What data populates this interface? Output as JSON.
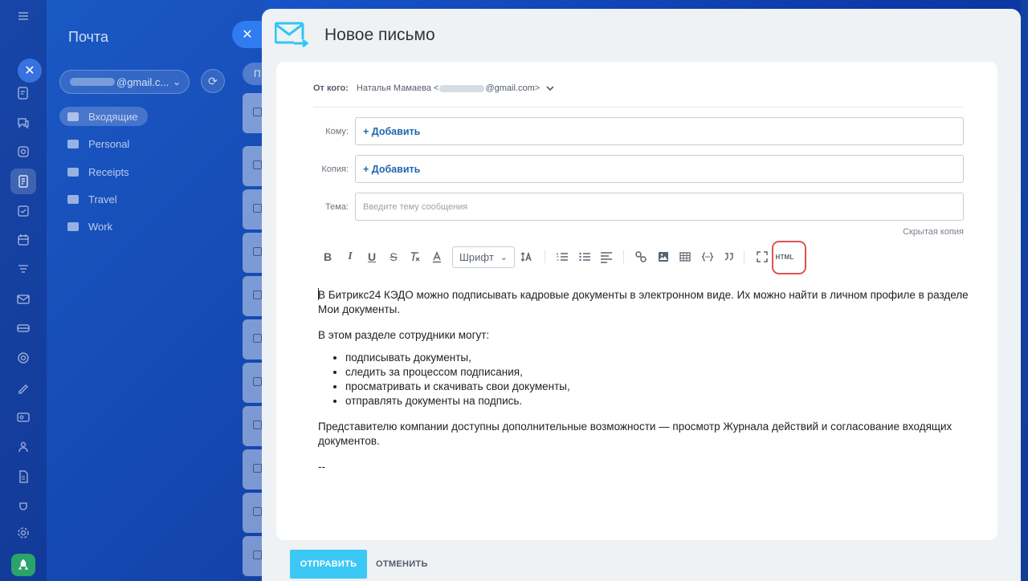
{
  "colors": {
    "accent": "#3bc8f5",
    "link": "#2067b0",
    "highlight": "#e05252",
    "backdrop": "#0d3aa8"
  },
  "rail": {
    "icons": [
      "menu-icon",
      "close-icon",
      "tasks-icon",
      "chat-icon",
      "crm-icon",
      "documents-icon",
      "checkbox-icon",
      "calendar-icon",
      "filter-icon",
      "mail-icon",
      "drive-icon",
      "target-icon",
      "sign-icon",
      "contact-card-icon",
      "employees-icon",
      "file-icon",
      "bug-icon",
      "settings-icon",
      "rocket-icon"
    ]
  },
  "mail": {
    "title": "Почта",
    "account_suffix": "@gmail.c...",
    "filter_stub": "П",
    "folders": [
      {
        "label": "Входящие",
        "icon": "inbox-icon",
        "active": true
      },
      {
        "label": "Personal",
        "icon": "folder-icon"
      },
      {
        "label": "Receipts",
        "icon": "folder-icon"
      },
      {
        "label": "Travel",
        "icon": "folder-icon"
      },
      {
        "label": "Work",
        "icon": "folder-icon"
      }
    ]
  },
  "compose": {
    "title": "Новое письмо",
    "from_label": "От кого:",
    "from_name": "Наталья Мамаева <",
    "from_domain": "@gmail.com>",
    "to_label": "Кому:",
    "to_add": "+ Добавить",
    "cc_label": "Копия:",
    "cc_add": "+ Добавить",
    "subject_label": "Тема:",
    "subject_placeholder": "Введите тему сообщения",
    "bcc_link": "Скрытая копия"
  },
  "toolbar": {
    "bold": "B",
    "italic": "I",
    "underline": "U",
    "strike": "S",
    "font_select": "Шрифт",
    "html": "HTML"
  },
  "body": {
    "para1": "В Битрикс24 КЭДО можно подписывать кадровые документы в электронном виде. Их можно найти в личном профиле в разделе Мои документы.",
    "para2": "В этом разделе сотрудники могут:",
    "bullets": [
      "подписывать документы,",
      "следить за процессом подписания,",
      "просматривать и скачивать свои документы,",
      "отправлять документы на подпись."
    ],
    "para3": "Представителю компании доступны дополнительные возможности — просмотр Журнала действий и согласование входящих документов.",
    "signature": "--"
  },
  "footer": {
    "send": "ОТПРАВИТЬ",
    "cancel": "ОТМЕНИТЬ"
  }
}
